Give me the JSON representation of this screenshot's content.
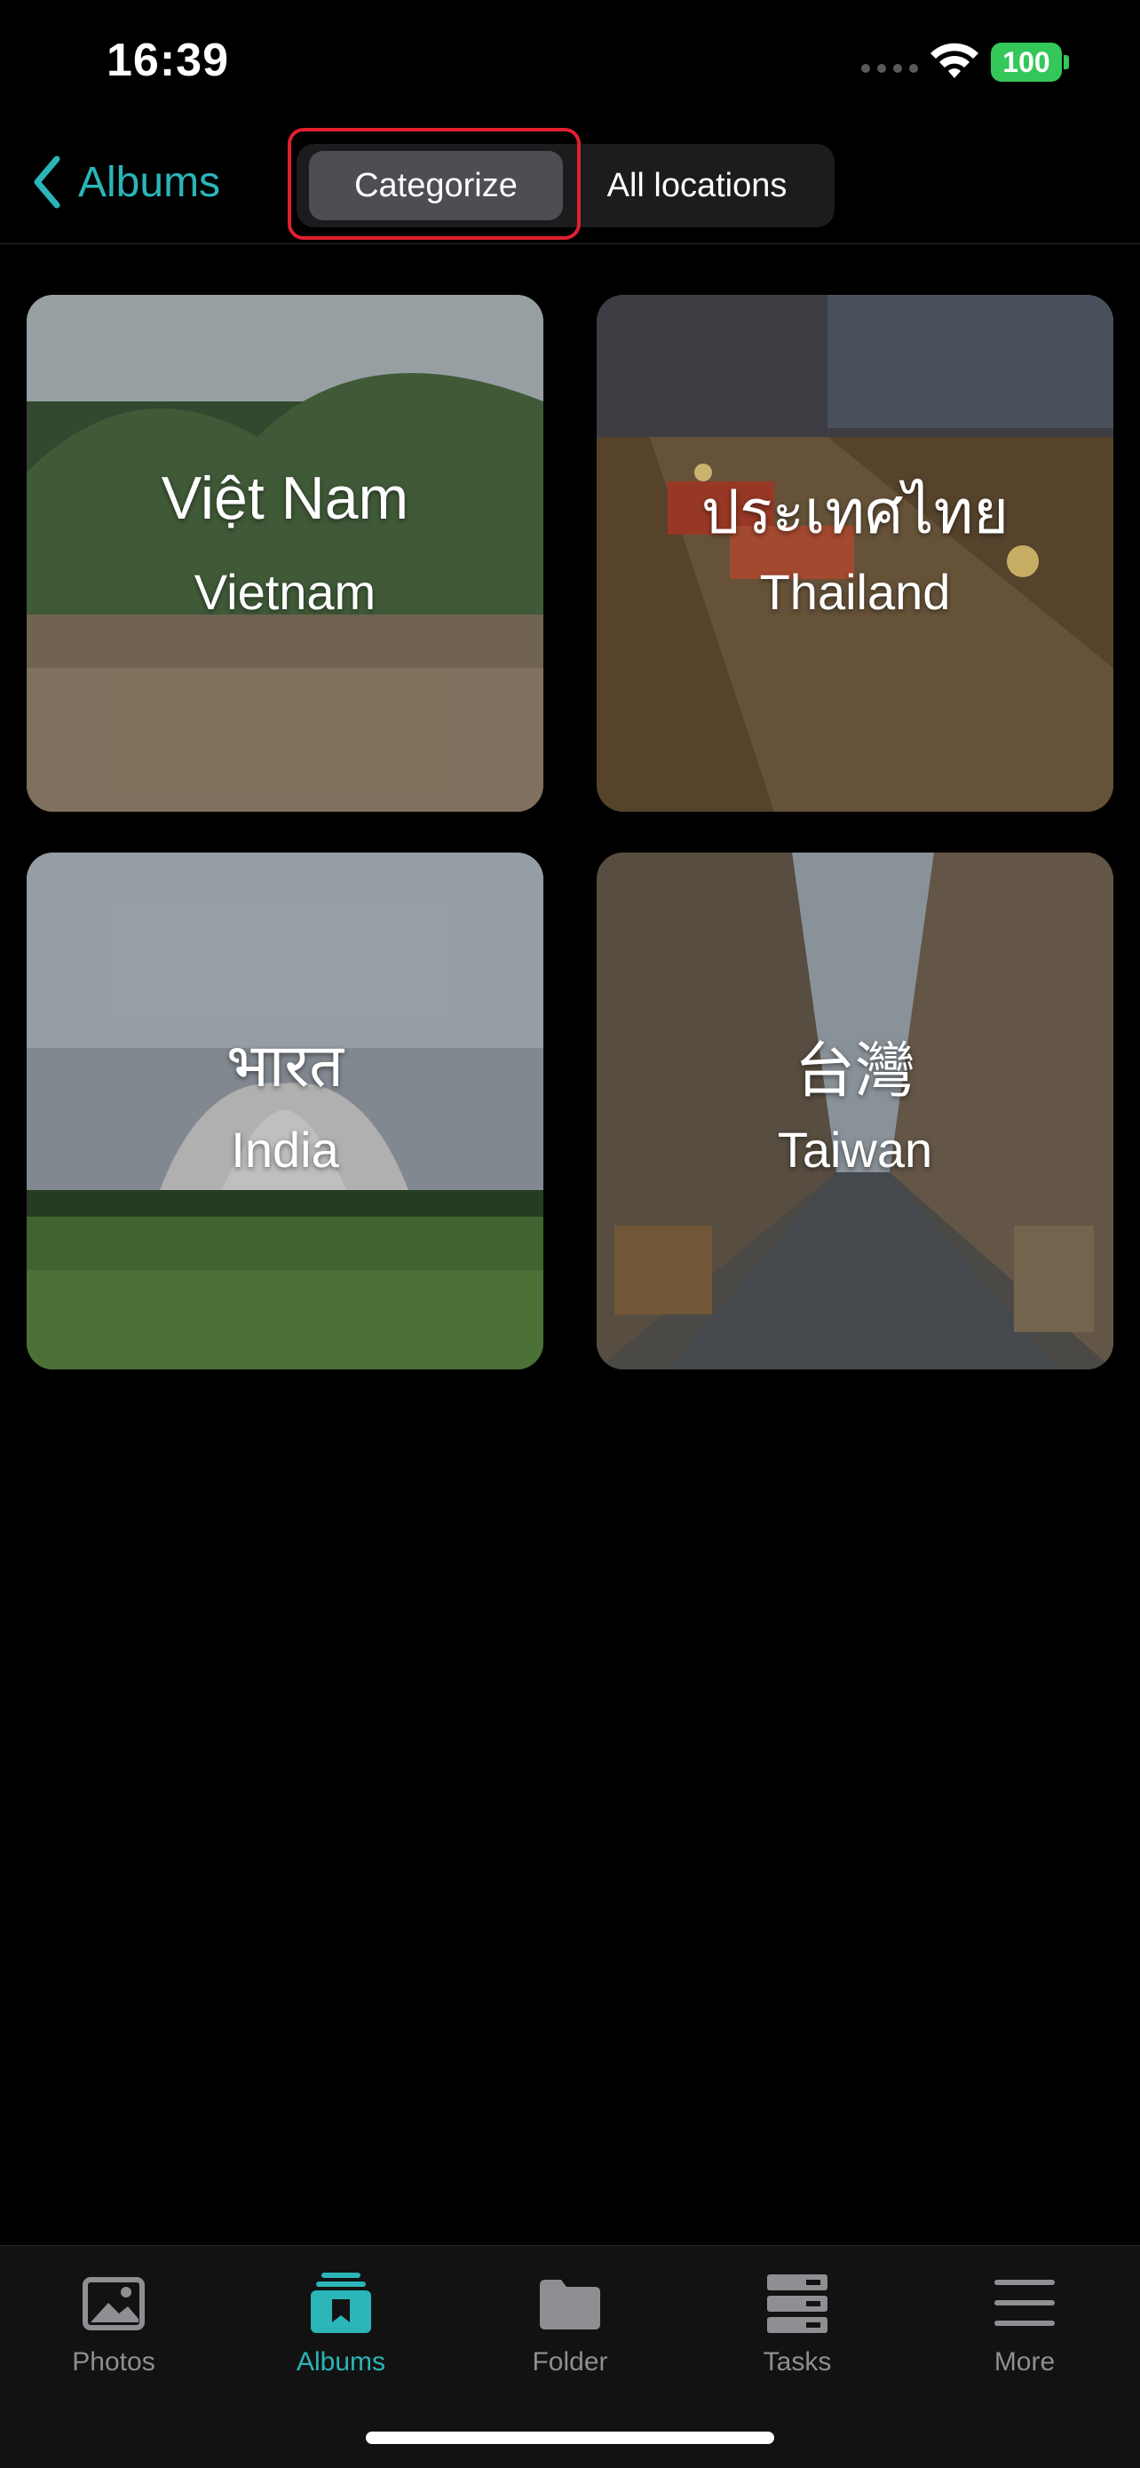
{
  "status_bar": {
    "time": "16:39",
    "battery": "100"
  },
  "nav": {
    "back_label": "Albums",
    "segments": [
      {
        "label": "Categorize",
        "selected": true
      },
      {
        "label": "All locations",
        "selected": false
      }
    ]
  },
  "albums": [
    {
      "native": "Việt Nam",
      "english": "Vietnam"
    },
    {
      "native": "ประเทศไทย",
      "english": "Thailand"
    },
    {
      "native": "भारत",
      "english": "India"
    },
    {
      "native": "台灣",
      "english": "Taiwan"
    }
  ],
  "tabs": [
    {
      "label": "Photos",
      "icon": "photos-icon"
    },
    {
      "label": "Albums",
      "icon": "albums-icon",
      "active": true
    },
    {
      "label": "Folder",
      "icon": "folder-icon"
    },
    {
      "label": "Tasks",
      "icon": "tasks-icon"
    },
    {
      "label": "More",
      "icon": "more-icon"
    }
  ],
  "colors": {
    "accent": "#2bb5b8",
    "highlight": "#e0202e",
    "battery": "#34c759"
  }
}
